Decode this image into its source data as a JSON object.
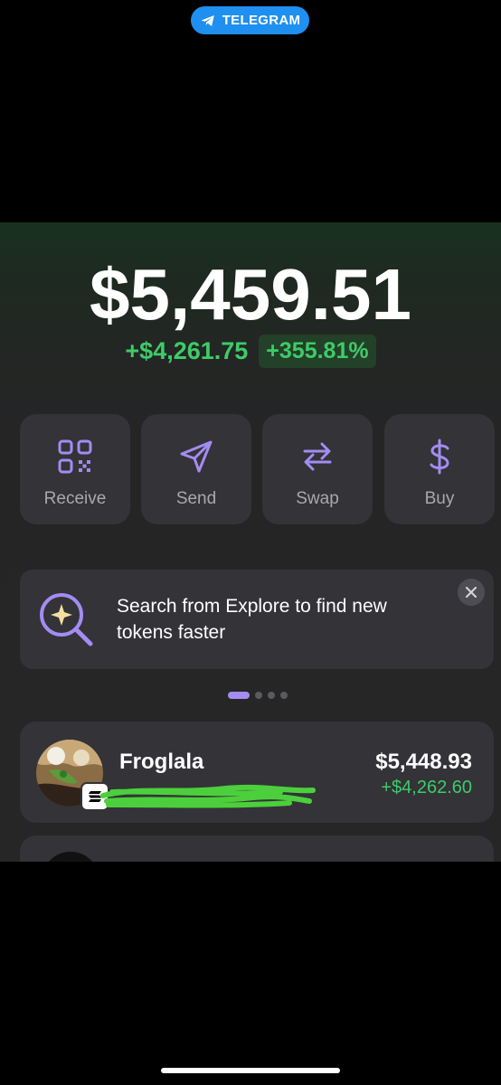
{
  "telegram_pill": {
    "label": "TELEGRAM",
    "icon": "telegram-icon",
    "color": "#1f8ff0"
  },
  "balance": {
    "value": "$5,459.51",
    "change_abs": "+$4,261.75",
    "change_pct": "+355.81%",
    "positive_color": "#3ecb68"
  },
  "actions": [
    {
      "label": "Receive",
      "icon": "qr-code-icon"
    },
    {
      "label": "Send",
      "icon": "send-icon"
    },
    {
      "label": "Swap",
      "icon": "swap-icon"
    },
    {
      "label": "Buy",
      "icon": "dollar-icon"
    }
  ],
  "accent_color": "#a38cf2",
  "banner": {
    "text": "Search from Explore to find new tokens faster",
    "icon": "search-sparkle-icon",
    "close_icon": "close-icon"
  },
  "pagination": {
    "count": 4,
    "active": 0
  },
  "tokens": [
    {
      "name": "Froglala",
      "value": "$5,448.93",
      "change": "+$4,262.60",
      "chain_icon": "solana-icon"
    }
  ]
}
